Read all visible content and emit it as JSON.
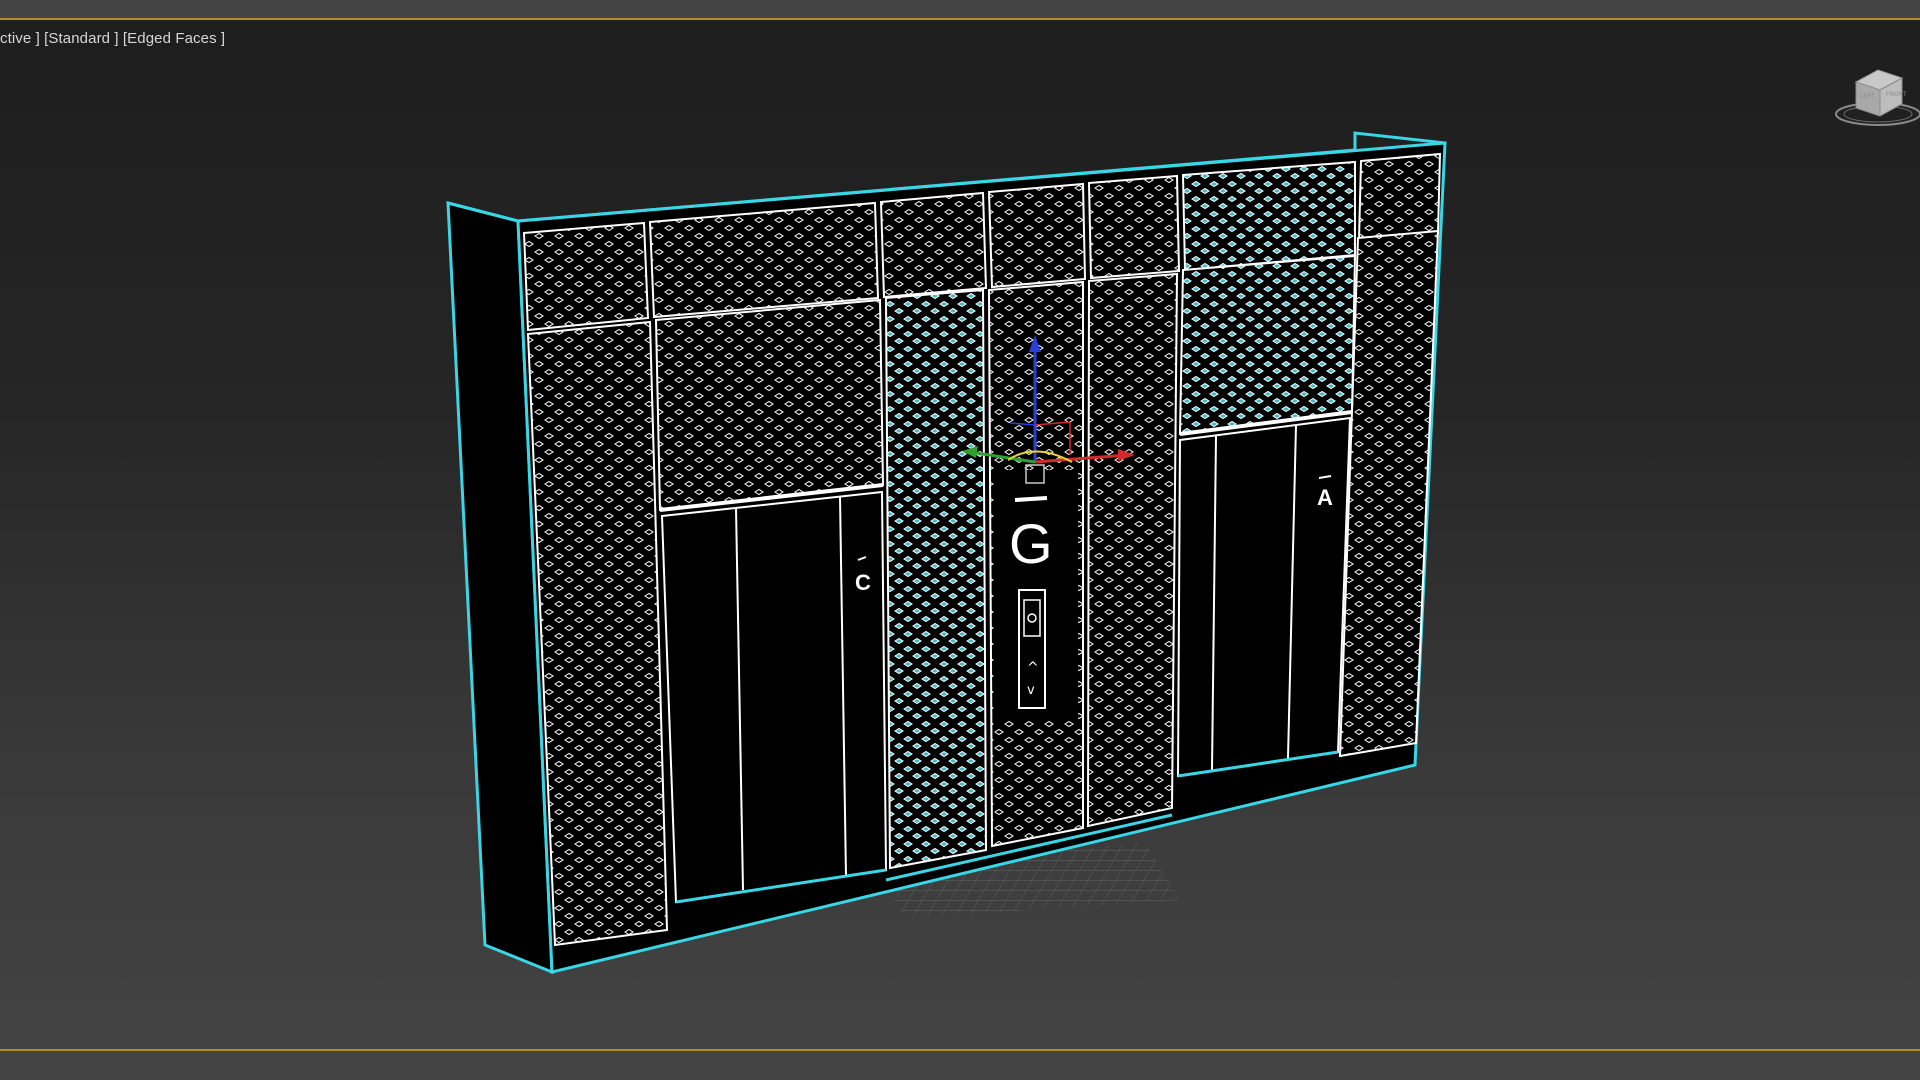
{
  "viewport": {
    "label_parts": [
      "ctive ]",
      " [Standard ]",
      " [Edged Faces ]"
    ]
  },
  "scene": {
    "signs": {
      "center": "G",
      "left": "C",
      "right": "A"
    },
    "call_panel": {
      "up_symbol": "^",
      "down_symbol": "v"
    }
  },
  "gizmo": {
    "axis_colors": {
      "x": "#d42a2a",
      "y": "#2ea12e",
      "z": "#2b3fd6",
      "plane": "#e8d433"
    }
  },
  "colors": {
    "selection_outline": "#39d6e6",
    "wire": "#ffffff",
    "frame_accent": "#b08d2b"
  },
  "icons": {
    "viewcube": "viewcube-icon"
  }
}
